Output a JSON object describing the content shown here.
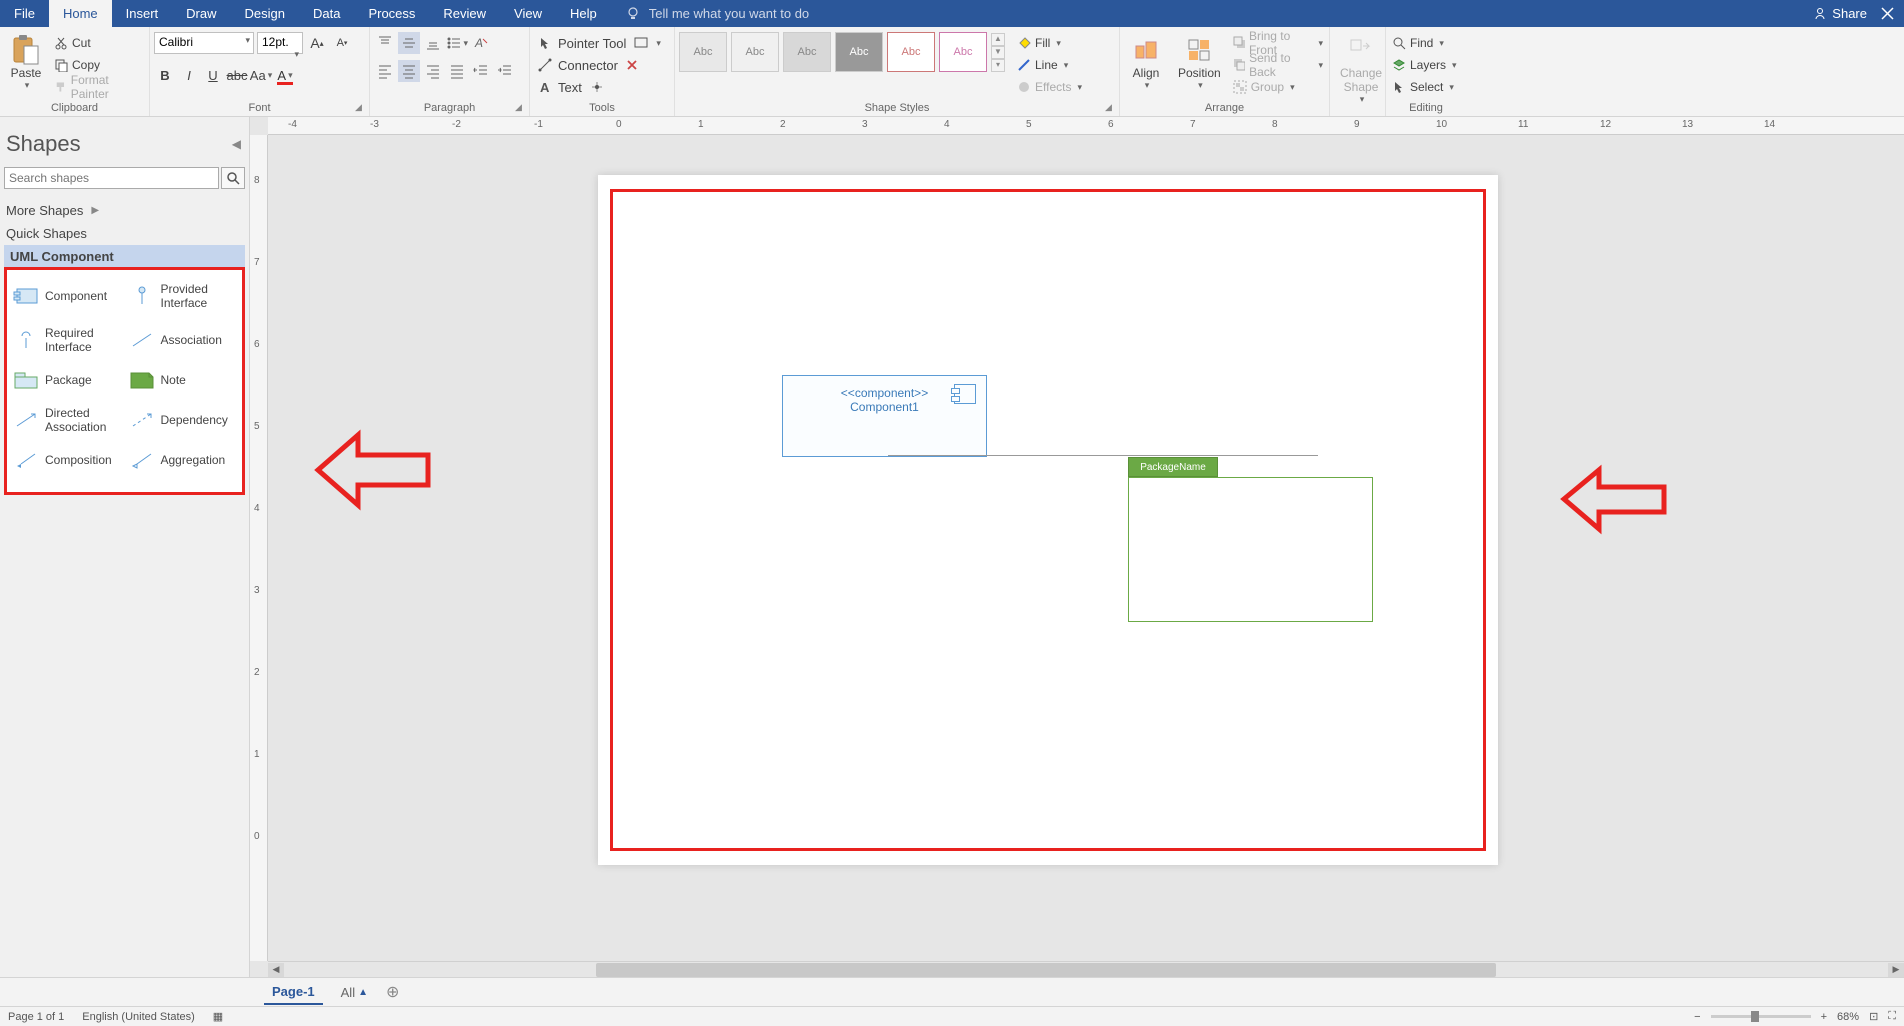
{
  "menu": {
    "file": "File",
    "home": "Home",
    "insert": "Insert",
    "draw": "Draw",
    "design": "Design",
    "data": "Data",
    "process": "Process",
    "review": "Review",
    "view": "View",
    "help": "Help",
    "tellme": "Tell me what you want to do",
    "share": "Share"
  },
  "ribbon": {
    "clipboard": {
      "label": "Clipboard",
      "paste": "Paste",
      "cut": "Cut",
      "copy": "Copy",
      "format_painter": "Format Painter"
    },
    "font": {
      "label": "Font",
      "name": "Calibri",
      "size": "12pt."
    },
    "paragraph": {
      "label": "Paragraph"
    },
    "tools": {
      "label": "Tools",
      "pointer": "Pointer Tool",
      "connector": "Connector",
      "text": "Text"
    },
    "shape_styles": {
      "label": "Shape Styles",
      "abc": "Abc",
      "fill": "Fill",
      "line": "Line",
      "effects": "Effects"
    },
    "arrange": {
      "label": "Arrange",
      "align": "Align",
      "position": "Position",
      "bring_front": "Bring to Front",
      "send_back": "Send to Back",
      "group": "Group"
    },
    "change_shape": {
      "change": "Change",
      "shape": "Shape"
    },
    "editing": {
      "label": "Editing",
      "find": "Find",
      "layers": "Layers",
      "select": "Select"
    }
  },
  "shapes": {
    "title": "Shapes",
    "search_placeholder": "Search shapes",
    "more": "More Shapes",
    "quick": "Quick Shapes",
    "stencil": "UML Component",
    "items": [
      "Component",
      "Provided Interface",
      "Required Interface",
      "Association",
      "Package",
      "Note",
      "Directed Association",
      "Dependency",
      "Composition",
      "Aggregation"
    ]
  },
  "canvas": {
    "component_stereo": "<<component>>",
    "component_name": "Component1",
    "package_name": "PackageName",
    "hruler": [
      "-4",
      "-3",
      "-2",
      "-1",
      "0",
      "1",
      "2",
      "3",
      "4",
      "5",
      "6",
      "7",
      "8",
      "9",
      "10",
      "11",
      "12",
      "13",
      "14"
    ],
    "vruler": [
      "8",
      "7",
      "6",
      "5",
      "4",
      "3",
      "2",
      "1",
      "0"
    ]
  },
  "pagetabs": {
    "page1": "Page-1",
    "all": "All"
  },
  "status": {
    "page": "Page 1 of 1",
    "lang": "English (United States)",
    "zoom": "68%"
  }
}
